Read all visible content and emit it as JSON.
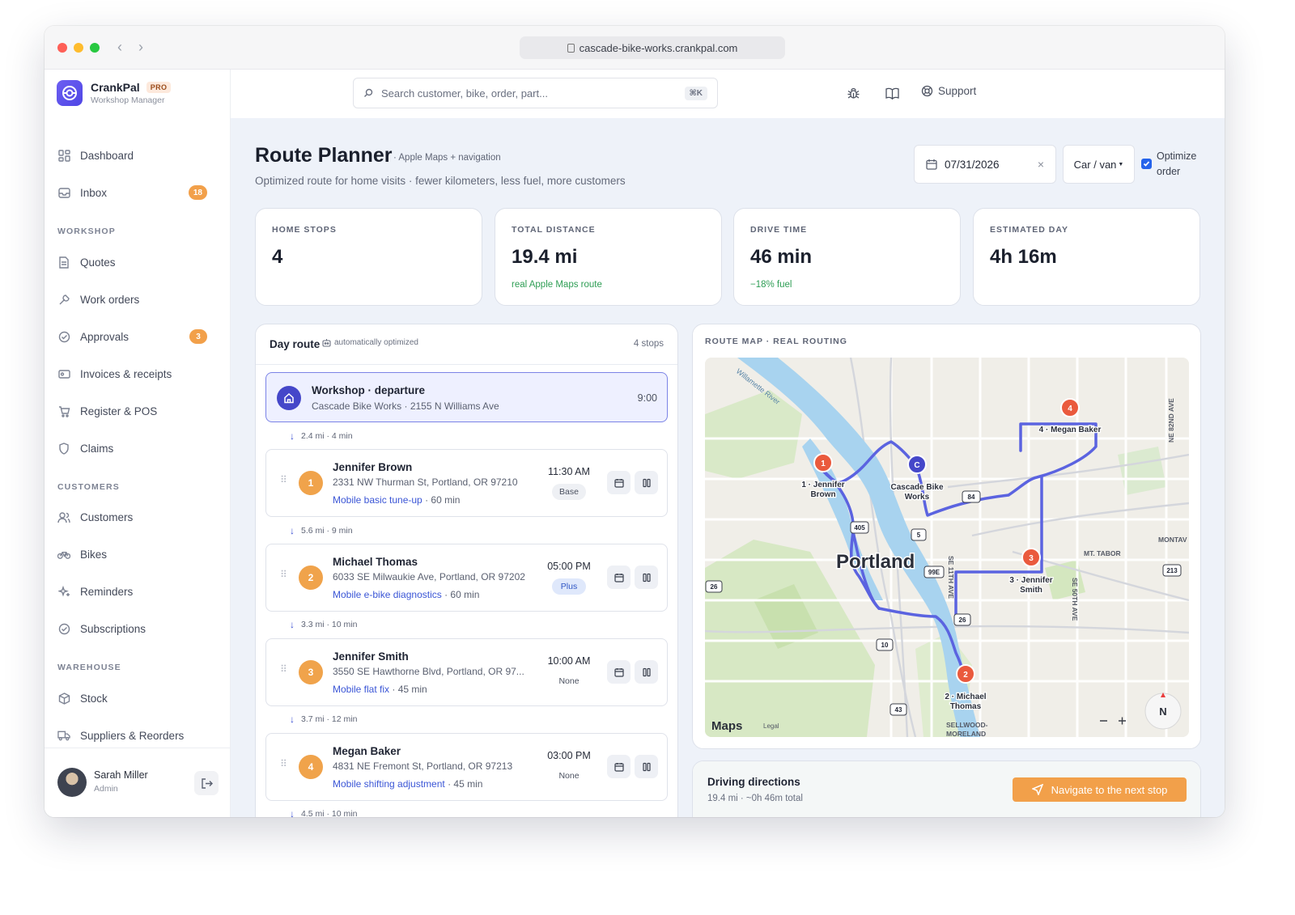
{
  "browser": {
    "url": "cascade-bike-works.crankpal.com"
  },
  "brand": {
    "name": "CrankPal",
    "badge": "PRO",
    "subtitle": "Workshop Manager"
  },
  "sidebar": {
    "top_items": [
      {
        "label": "Dashboard",
        "icon": "dashboard-icon"
      },
      {
        "label": "Inbox",
        "icon": "inbox-icon",
        "badge": "18"
      }
    ],
    "sections": [
      {
        "title": "WORKSHOP",
        "items": [
          {
            "label": "Quotes",
            "icon": "document-icon"
          },
          {
            "label": "Work orders",
            "icon": "wrench-icon"
          },
          {
            "label": "Approvals",
            "icon": "check-circle-icon",
            "badge": "3"
          },
          {
            "label": "Invoices & receipts",
            "icon": "receipt-icon"
          },
          {
            "label": "Register & POS",
            "icon": "cart-icon"
          },
          {
            "label": "Claims",
            "icon": "shield-icon"
          }
        ]
      },
      {
        "title": "CUSTOMERS",
        "items": [
          {
            "label": "Customers",
            "icon": "users-icon"
          },
          {
            "label": "Bikes",
            "icon": "bike-icon"
          },
          {
            "label": "Reminders",
            "icon": "sparkle-icon"
          },
          {
            "label": "Subscriptions",
            "icon": "check-circle-icon"
          }
        ]
      },
      {
        "title": "WAREHOUSE",
        "items": [
          {
            "label": "Stock",
            "icon": "box-icon"
          },
          {
            "label": "Suppliers & Reorders",
            "icon": "truck-icon"
          }
        ]
      }
    ],
    "user": {
      "name": "Sarah Miller",
      "role": "Admin"
    }
  },
  "topbar": {
    "search_placeholder": "Search customer, bike, order, part...",
    "search_shortcut": "⌘K",
    "support_label": "Support"
  },
  "page": {
    "title": "Route Planner",
    "tag": "· Apple Maps + navigation",
    "subtitle": "Optimized route for home visits · fewer kilometers, less fuel, more customers",
    "date": "07/31/2026",
    "vehicle": "Car / van",
    "optimize_label": "Optimize order",
    "optimize_checked": true
  },
  "stats": [
    {
      "label": "HOME STOPS",
      "value": "4",
      "note": ""
    },
    {
      "label": "TOTAL DISTANCE",
      "value": "19.4 mi",
      "note": "real Apple Maps route"
    },
    {
      "label": "DRIVE TIME",
      "value": "46 min",
      "note": "−18% fuel"
    },
    {
      "label": "ESTIMATED DAY",
      "value": "4h 16m",
      "note": ""
    }
  ],
  "route": {
    "title": "Day route",
    "auto_label": "automatically optimized",
    "count_label": "4 stops",
    "departure": {
      "title": "Workshop · departure",
      "address": "Cascade Bike Works · 2155 N Williams Ave",
      "time": "9:00"
    },
    "legs": [
      "2.4 mi · 4 min",
      "5.6 mi · 9 min",
      "3.3 mi · 10 min",
      "3.7 mi · 12 min",
      "4.5 mi · 10 min"
    ],
    "stops": [
      {
        "num": "1",
        "name": "Jennifer Brown",
        "address": "2331 NW Thurman St, Portland, OR 97210",
        "service": "Mobile basic tune-up",
        "duration": "· 60 min",
        "time": "11:30 AM",
        "plan": "Base",
        "plan_style": "base"
      },
      {
        "num": "2",
        "name": "Michael Thomas",
        "address": "6033 SE Milwaukie Ave, Portland, OR 97202",
        "service": "Mobile e-bike diagnostics",
        "duration": "· 60 min",
        "time": "05:00 PM",
        "plan": "Plus",
        "plan_style": "plus"
      },
      {
        "num": "3",
        "name": "Jennifer Smith",
        "address": "3550 SE Hawthorne Blvd, Portland, OR 97...",
        "service": "Mobile flat fix",
        "duration": "· 45 min",
        "time": "10:00 AM",
        "plan": "None",
        "plan_style": "none"
      },
      {
        "num": "4",
        "name": "Megan Baker",
        "address": "4831 NE Fremont St, Portland, OR 97213",
        "service": "Mobile shifting adjustment",
        "duration": "· 45 min",
        "time": "03:00 PM",
        "plan": "None",
        "plan_style": "none"
      }
    ]
  },
  "map": {
    "title": "ROUTE MAP · REAL ROUTING",
    "city_label": "Portland",
    "river_label": "Willamette River",
    "markers": [
      {
        "id": "C",
        "label": "Cascade Bike Works",
        "color": "#4547c9"
      },
      {
        "id": "1",
        "label": "1 · Jennifer Brown",
        "color": "#ea5a3d"
      },
      {
        "id": "2",
        "label": "2 · Michael Thomas",
        "color": "#ea5a3d"
      },
      {
        "id": "3",
        "label": "3 · Jennifer Smith",
        "color": "#ea5a3d"
      },
      {
        "id": "4",
        "label": "4 · Megan Baker",
        "color": "#ea5a3d"
      }
    ],
    "street_labels": [
      "MT. TABOR",
      "MONTAV",
      "SE 11TH AVE",
      "SE 50TH AVE",
      "NE 82ND AVE",
      "SELLWOOD-MORELAND"
    ],
    "shields": [
      "405",
      "5",
      "84",
      "99E",
      "26",
      "10",
      "43",
      "213",
      "26"
    ],
    "attribution": "Maps",
    "legal": "Legal",
    "compass": "N",
    "route_color": "#5b63e0"
  },
  "directions": {
    "title": "Driving directions",
    "summary": "19.4 mi · ~0h 46m total",
    "navigate_label": "Navigate to the next stop"
  }
}
